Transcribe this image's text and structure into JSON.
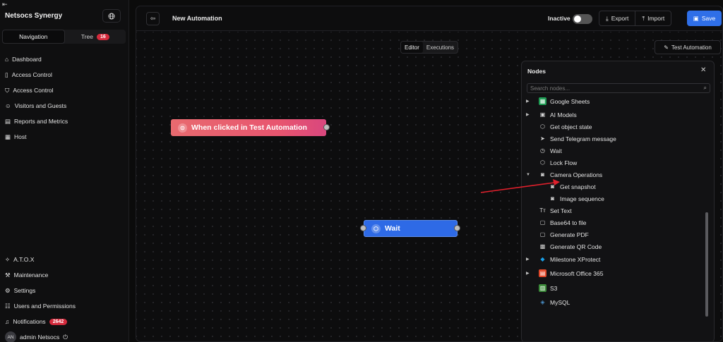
{
  "sidebar": {
    "brand": "Netsocs Synergy",
    "collapse_icon": "collapse-left-icon",
    "toggles": {
      "navigation": "Navigation",
      "tree": "Tree",
      "tree_badge": "16"
    },
    "nav": [
      {
        "label": "Dashboard",
        "icon": "home-icon"
      },
      {
        "label": "Access Control",
        "icon": "door-icon"
      },
      {
        "label": "Access Control",
        "icon": "shield-icon"
      },
      {
        "label": "Visitors and Guests",
        "icon": "user-icon"
      },
      {
        "label": "Reports and Metrics",
        "icon": "chart-icon"
      },
      {
        "label": "Host",
        "icon": "server-icon"
      }
    ],
    "bottom": [
      {
        "label": "A.T.O.X",
        "icon": "sparkles-icon"
      },
      {
        "label": "Maintenance",
        "icon": "wrench-icon"
      },
      {
        "label": "Settings",
        "icon": "gear-icon"
      },
      {
        "label": "Users and Permissions",
        "icon": "users-icon"
      },
      {
        "label": "Notifications",
        "icon": "bell-icon",
        "badge": "2642"
      }
    ],
    "user": {
      "initials": "AN",
      "name": "admin Netsocs"
    }
  },
  "topbar": {
    "title": "New Automation",
    "status_label": "Inactive",
    "export_label": "Export",
    "import_label": "Import",
    "save_label": "Save"
  },
  "canvas": {
    "tabs": [
      "Editor",
      "Executions"
    ],
    "active_tab": "Editor",
    "test_label": "Test Automation",
    "nodes": {
      "trigger": "When clicked in Test Automation",
      "wait": "Wait"
    }
  },
  "panel": {
    "title": "Nodes",
    "search_placeholder": "Search nodes...",
    "items": [
      {
        "label": "Google Sheets",
        "caret": true
      },
      {
        "label": "AI Models",
        "caret": true
      },
      {
        "label": "Get object state"
      },
      {
        "label": "Send Telegram message"
      },
      {
        "label": "Wait"
      },
      {
        "label": "Lock Flow"
      },
      {
        "label": "Camera Operations",
        "caret": "open"
      },
      {
        "label": "Get snapshot",
        "child": true
      },
      {
        "label": "Image sequence",
        "child": true
      },
      {
        "label": "Set Text"
      },
      {
        "label": "Base64 to file"
      },
      {
        "label": "Generate PDF"
      },
      {
        "label": "Generate QR Code"
      },
      {
        "label": "Milestone XProtect",
        "caret": true
      },
      {
        "label": "Microsoft Office 365",
        "caret": true
      },
      {
        "label": "S3"
      },
      {
        "label": "MySQL"
      }
    ]
  },
  "colors": {
    "accent": "#2f6fe8",
    "trigger": "#e8556f",
    "badge": "#d42a3c",
    "arrow": "#e0202c"
  }
}
